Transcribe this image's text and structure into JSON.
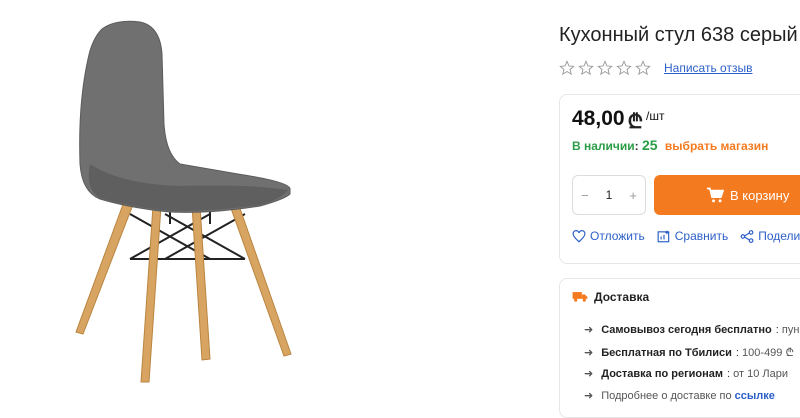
{
  "product": {
    "title": "Кухонный стул 638 серый",
    "review_link": "Написать отзыв",
    "rating_stars": 5,
    "rating_value": 0,
    "image": "chair-gray-wooden-legs"
  },
  "price": {
    "value": "48,00",
    "currency": "₾",
    "unit": "/шт"
  },
  "stock": {
    "label": "В наличии",
    "separator": ":",
    "count": "25",
    "store_link": "выбрать магазин"
  },
  "quantity": {
    "minus": "−",
    "value": "1",
    "plus": "+"
  },
  "cart_button": {
    "label": "В корзину",
    "icon": "cart-icon"
  },
  "actions": [
    {
      "label": "Отложить",
      "icon": "heart-icon"
    },
    {
      "label": "Сравнить",
      "icon": "compare-icon"
    },
    {
      "label": "Поделить",
      "icon": "share-icon"
    }
  ],
  "delivery": {
    "title": "Доставка",
    "icon": "truck-icon",
    "rows": [
      {
        "bold": "Самовывоз сегодня бесплатно",
        "sep": ":",
        "rest": "пун"
      },
      {
        "bold": "Бесплатная по Тбилиси",
        "sep": ":",
        "rest": "100-499 ₾"
      },
      {
        "bold": "Доставка по регионам",
        "sep": ":",
        "rest": "от 10 Лари"
      },
      {
        "bold": "",
        "sep": "",
        "rest": "Подробнее о доставке по",
        "link": "ссылке"
      }
    ]
  },
  "colors": {
    "accent": "#f47a20",
    "link": "#2c5fc8",
    "in_stock": "#2a9d45",
    "chair_seat": "#6e6e6e",
    "chair_legs": "#d8a461"
  }
}
